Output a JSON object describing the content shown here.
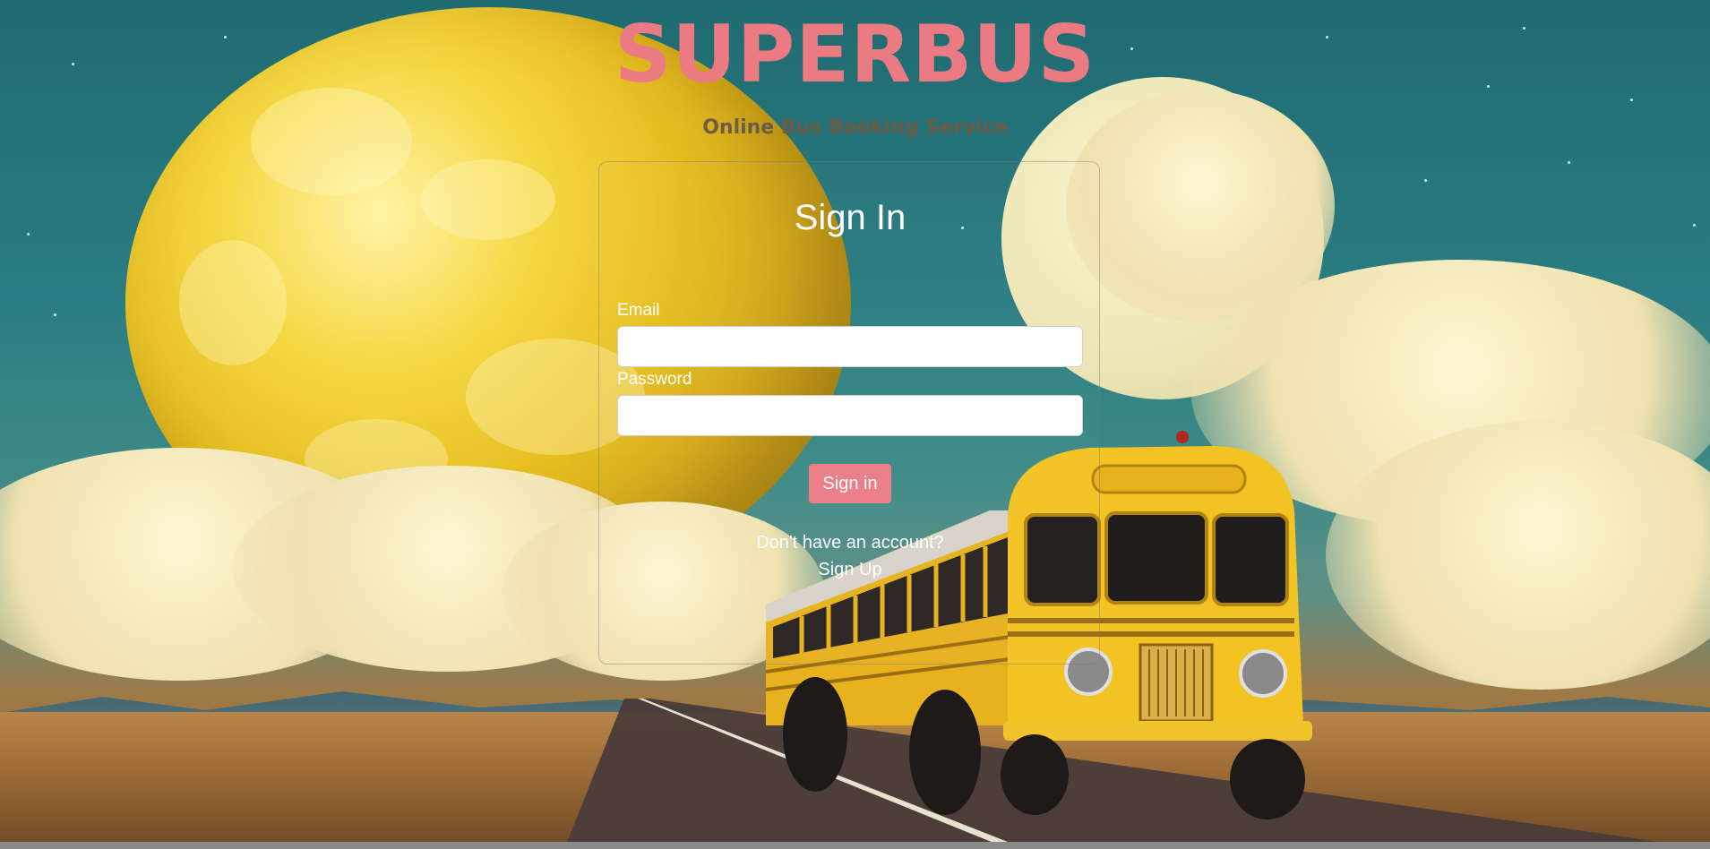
{
  "header": {
    "brand": "SUPERBUS",
    "subtitle": "Online Bus Booking Service"
  },
  "signin": {
    "title": "Sign In",
    "email_label": "Email",
    "email_value": "",
    "password_label": "Password",
    "password_value": "",
    "submit_label": "Sign in",
    "no_account_text": "Don't have an account?",
    "signup_label": "Sign Up"
  },
  "colors": {
    "brand": "#ec7a82",
    "button": "#ec8088",
    "subtitle": "#6d5b45"
  },
  "background": {
    "icons": [
      "moon-icon",
      "bus-icon",
      "cloud-icon"
    ]
  }
}
